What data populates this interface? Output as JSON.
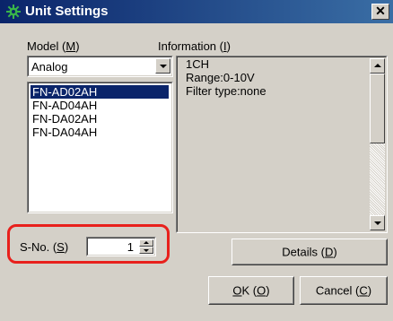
{
  "window": {
    "title": "Unit Settings",
    "close_glyph": "✕"
  },
  "model": {
    "label_prefix": "Model (",
    "label_key": "M",
    "label_suffix": ")",
    "selected_value": "Analog",
    "list": [
      "FN-AD02AH",
      "FN-AD04AH",
      "FN-DA02AH",
      "FN-DA04AH"
    ]
  },
  "information": {
    "label_prefix": "Information (",
    "label_key": "I",
    "label_suffix": ")",
    "lines": [
      "1CH",
      "Range:0-10V",
      "Filter type:none"
    ]
  },
  "sno": {
    "label_prefix": "S-No. (",
    "label_key": "S",
    "label_suffix": ")",
    "value": "1"
  },
  "buttons": {
    "details_prefix": "Details (",
    "details_key": "D",
    "details_suffix": ")",
    "ok_key": "O",
    "ok_rest": "K (",
    "ok_key2": "O",
    "ok_suffix": ")",
    "cancel_prefix": "Cancel (",
    "cancel_key": "C",
    "cancel_suffix": ")"
  },
  "colors": {
    "highlight": "#e8201c",
    "selection": "#0a246a"
  },
  "icons": {
    "title_icon": "gear-icon"
  }
}
